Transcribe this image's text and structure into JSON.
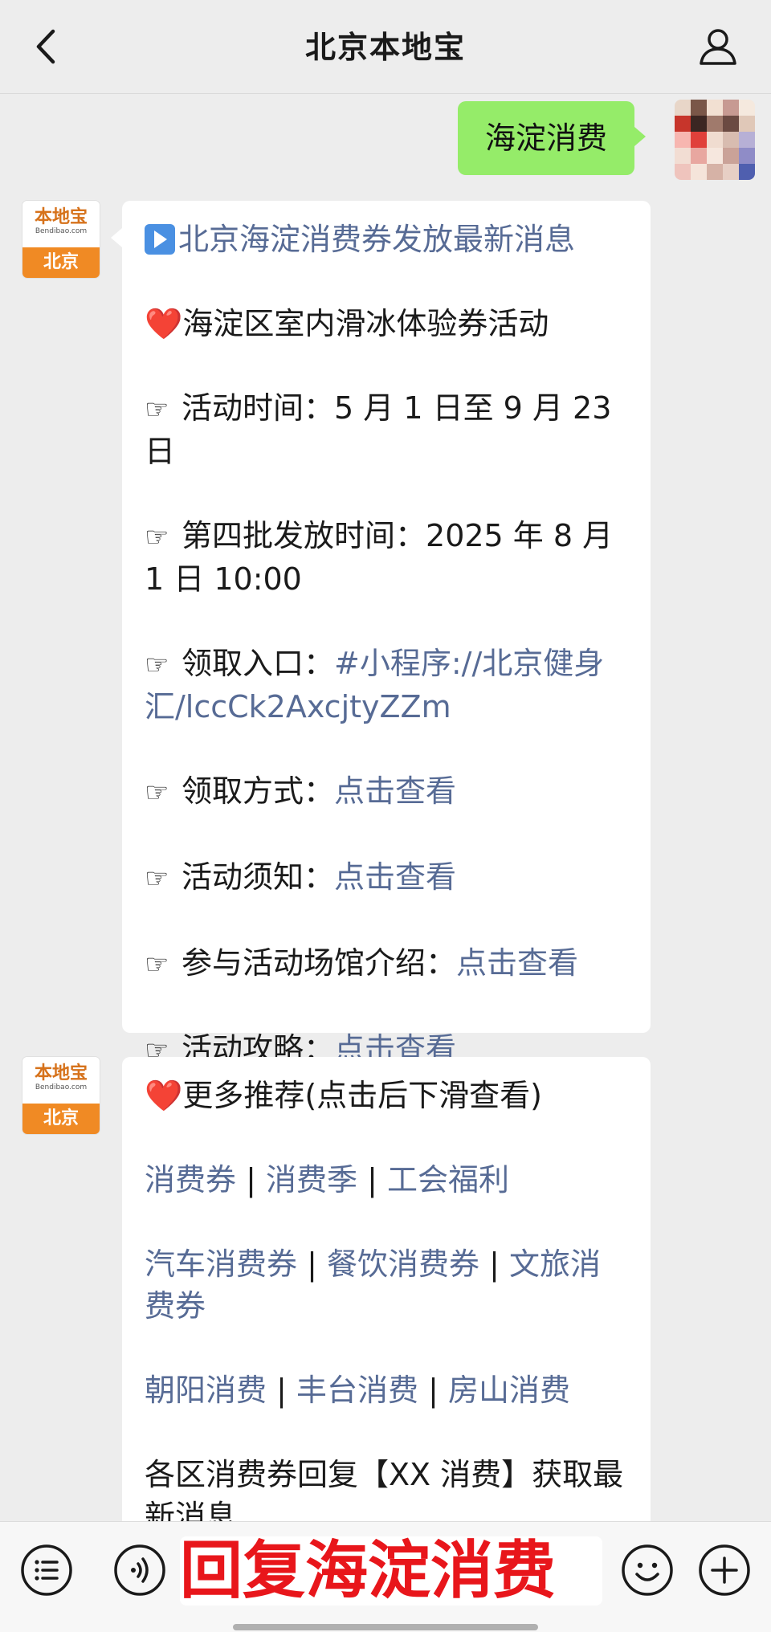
{
  "header": {
    "title": "北京本地宝",
    "back_icon": "chevron-left-icon",
    "profile_icon": "user-icon"
  },
  "outgoing": {
    "text": "海淀消费"
  },
  "bot": {
    "logo_main": "本地宝",
    "logo_domain": "Bendibao.com",
    "logo_city": "北京"
  },
  "message1": {
    "headline": "北京海淀消费券发放最新消息",
    "heart": "❤️",
    "activity_title": "海淀区室内滑冰体验券活动",
    "hand": "☞",
    "time_label": "活动时间：",
    "time_value": "5 月 1 日至 9 月 23 日",
    "batch_label": "第四批发放时间：",
    "batch_value": "2025 年 8 月 1 日 10:00",
    "entry_label": "领取入口：",
    "entry_link": "#小程序://北京健身汇/lccCk2AxcjtyZZm",
    "method_label": "领取方式：",
    "method_link": "点击查看",
    "notice_label": "活动须知：",
    "notice_link": "点击查看",
    "venue_label": "参与活动场馆介绍：",
    "venue_link": "点击查看",
    "guide_label": "活动攻略：",
    "guide_link": "点击查看"
  },
  "message2": {
    "heart": "❤️",
    "more_title": "更多推荐(点击后下滑查看)",
    "separator": "|",
    "row1": [
      "消费券",
      "消费季",
      "工会福利"
    ],
    "row2": [
      "汽车消费券",
      "餐饮消费券",
      "文旅消费券"
    ],
    "row3": [
      "朝阳消费",
      "丰台消费",
      "房山消费"
    ],
    "footer_text": "各区消费券回复【XX 消费】获取最新消息"
  },
  "toolbar": {
    "menu_icon": "list-menu-icon",
    "voice_icon": "voice-icon",
    "input_text": "回复海淀消费",
    "emoji_icon": "emoji-icon",
    "add_icon": "plus-icon",
    "input_color": "#e8161b"
  },
  "colors": {
    "link": "#576b95",
    "outgoing_bubble": "#95ec69",
    "logo_orange": "#f08a24"
  }
}
